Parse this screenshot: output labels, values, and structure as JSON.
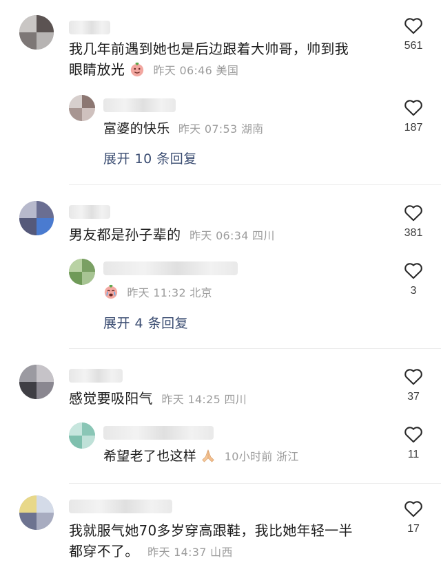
{
  "comments": [
    {
      "text_line1": "我几年前遇到她也是后边跟着大帅哥，帅到我",
      "text_line2": "眼睛放光",
      "meta": "昨天 06:46 美国",
      "likes": "561",
      "reply": {
        "text": "富婆的快乐",
        "meta": "昨天 07:53 湖南",
        "likes": "187"
      },
      "expand": "展开 10 条回复"
    },
    {
      "text": "男友都是孙子辈的",
      "meta": "昨天 06:34 四川",
      "likes": "381",
      "reply": {
        "meta": "昨天 11:32 北京",
        "likes": "3"
      },
      "expand": "展开 4 条回复"
    },
    {
      "text": "感觉要吸阳气",
      "meta": "昨天 14:25 四川",
      "likes": "37",
      "reply": {
        "text": "希望老了也这样",
        "meta": "10小时前 浙江",
        "likes": "11"
      }
    },
    {
      "text_line1": "我就服气她70多岁穿高跟鞋，我比她年轻一半",
      "text_line2": "都穿不了。",
      "meta": "昨天 14:37 山西",
      "likes": "17"
    }
  ]
}
